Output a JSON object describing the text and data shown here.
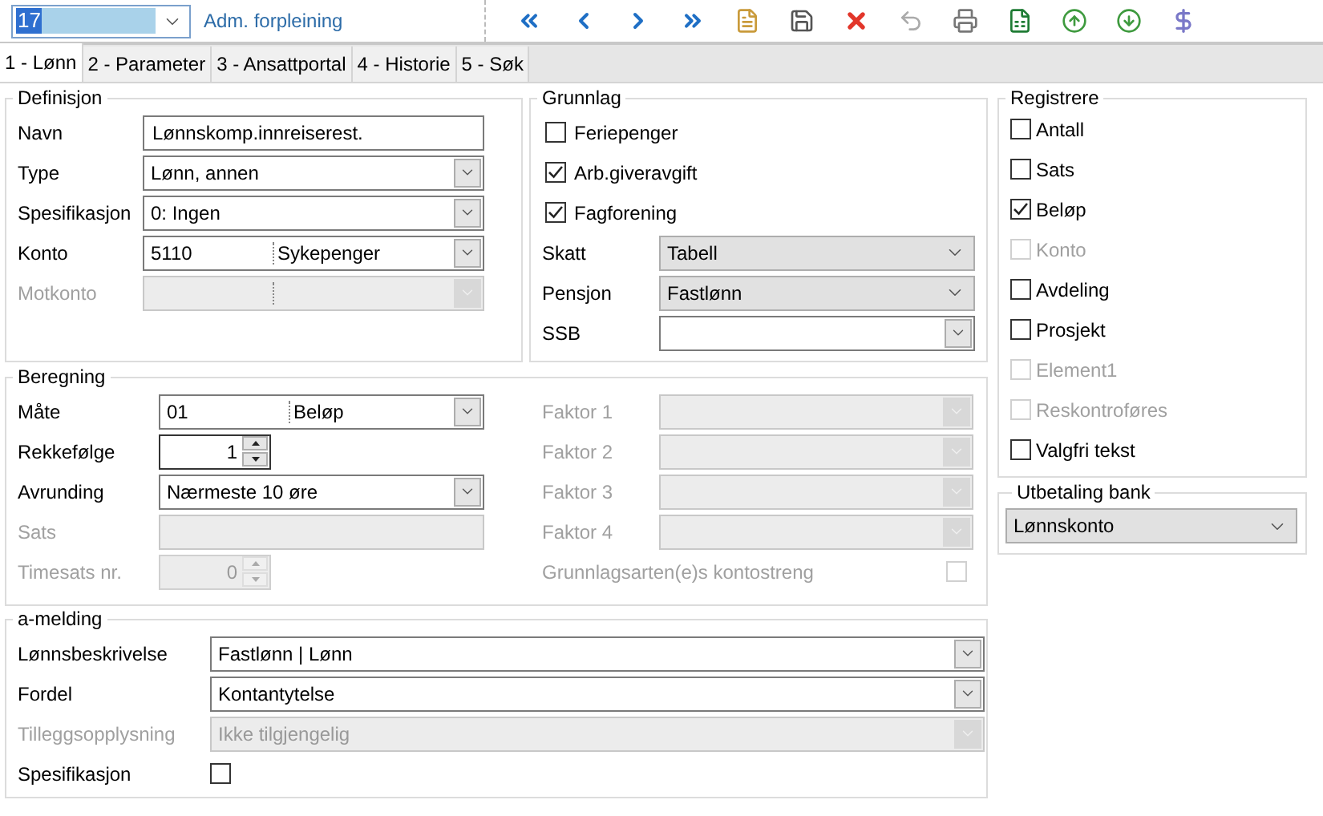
{
  "record": {
    "number": "17",
    "name": "Adm. forpleining"
  },
  "toolbar": [
    {
      "kind": "first"
    },
    {
      "kind": "previous"
    },
    {
      "kind": "next"
    },
    {
      "kind": "last"
    },
    {
      "kind": "new"
    },
    {
      "kind": "save"
    },
    {
      "kind": "delete"
    },
    {
      "kind": "undo",
      "disabled": true
    },
    {
      "kind": "print"
    },
    {
      "kind": "excel"
    },
    {
      "kind": "export"
    },
    {
      "kind": "import"
    },
    {
      "kind": "dollar"
    }
  ],
  "tabs": [
    {
      "label": "1 - Lønn",
      "selected": true
    },
    {
      "label": "2 - Parameter",
      "selected": false
    },
    {
      "label": "3 - Ansattportal",
      "selected": false
    },
    {
      "label": "4 - Historie",
      "selected": false
    },
    {
      "label": "5 - Søk",
      "selected": false
    }
  ],
  "definisjon": {
    "title": "Definisjon",
    "fields": [
      {
        "label": "Navn",
        "kind": "text",
        "value": "Lønnskomp.innreiserest.",
        "disabled": false
      },
      {
        "label": "Type",
        "kind": "combo",
        "value": "Lønn, annen",
        "disabled": false
      },
      {
        "label": "Spesifikasjon",
        "kind": "combo",
        "value": "0:  Ingen",
        "disabled": false
      },
      {
        "label": "Konto",
        "kind": "split",
        "code": "5110",
        "value": "Sykepenger",
        "disabled": false
      },
      {
        "label": "Motkonto",
        "kind": "split",
        "disabled": true
      }
    ]
  },
  "grunnlag": {
    "title": "Grunnlag",
    "fields": [
      {
        "label": "Feriepenger",
        "kind": "check",
        "checked": false,
        "disabled": false
      },
      {
        "label": "Arb.giveravgift",
        "kind": "check",
        "checked": true,
        "disabled": false
      },
      {
        "label": "Fagforening",
        "kind": "check",
        "checked": true,
        "disabled": false
      },
      {
        "label": "Skatt",
        "kind": "list",
        "value": "Tabell",
        "disabled": false
      },
      {
        "label": "Pensjon",
        "kind": "list",
        "value": "Fastlønn",
        "disabled": false
      },
      {
        "label": "SSB",
        "kind": "combo",
        "disabled": false
      }
    ]
  },
  "beregning": {
    "title": "Beregning",
    "fields": [
      {
        "label": "Måte",
        "kind": "split",
        "code": "01",
        "value": "Beløp",
        "disabled": false
      },
      {
        "label": "Rekkefølge",
        "kind": "spin",
        "value": "1",
        "disabled": false
      },
      {
        "label": "Avrunding",
        "kind": "combo",
        "value": "Nærmeste 10 øre",
        "disabled": false
      },
      {
        "label": "Sats",
        "kind": "text",
        "disabled": true
      },
      {
        "label": "Timesats nr.",
        "kind": "spin",
        "value": "0",
        "disabled": true
      }
    ],
    "factors": [
      {
        "label": "Faktor 1",
        "kind": "combo",
        "disabled": true
      },
      {
        "label": "Faktor 2",
        "kind": "combo",
        "disabled": true
      },
      {
        "label": "Faktor 3",
        "kind": "combo",
        "disabled": true
      },
      {
        "label": "Faktor 4",
        "kind": "combo",
        "disabled": true
      },
      {
        "label": "Grunnlagsarten(e)s kontostreng",
        "kind": "check_end",
        "checked": false,
        "disabled": true
      }
    ]
  },
  "a_melding": {
    "title": "a-melding",
    "fields": [
      {
        "label": "Lønnsbeskrivelse",
        "kind": "combo",
        "value": "Fastlønn | Lønn",
        "disabled": false
      },
      {
        "label": "Fordel",
        "kind": "combo",
        "value": "Kontantytelse",
        "disabled": false
      },
      {
        "label": "Tilleggsopplysning",
        "kind": "combo",
        "value": "Ikke tilgjengelig",
        "disabled": true
      },
      {
        "label": "Spesifikasjon",
        "kind": "check_field",
        "checked": false,
        "disabled": false
      }
    ]
  },
  "registrere": {
    "title": "Registrere",
    "items": [
      {
        "label": "Antall",
        "checked": false,
        "disabled": false
      },
      {
        "label": "Sats",
        "checked": false,
        "disabled": false
      },
      {
        "label": "Beløp",
        "checked": true,
        "disabled": false
      },
      {
        "label": "Konto",
        "checked": false,
        "disabled": true
      },
      {
        "label": "Avdeling",
        "checked": false,
        "disabled": false
      },
      {
        "label": "Prosjekt",
        "checked": false,
        "disabled": false
      },
      {
        "label": "Element1",
        "checked": false,
        "disabled": true
      },
      {
        "label": "Reskontroføres",
        "checked": false,
        "disabled": true
      },
      {
        "label": "Valgfri tekst",
        "checked": false,
        "disabled": false
      }
    ]
  },
  "utbetaling": {
    "title": "Utbetaling bank",
    "value": "Lønnskonto"
  }
}
